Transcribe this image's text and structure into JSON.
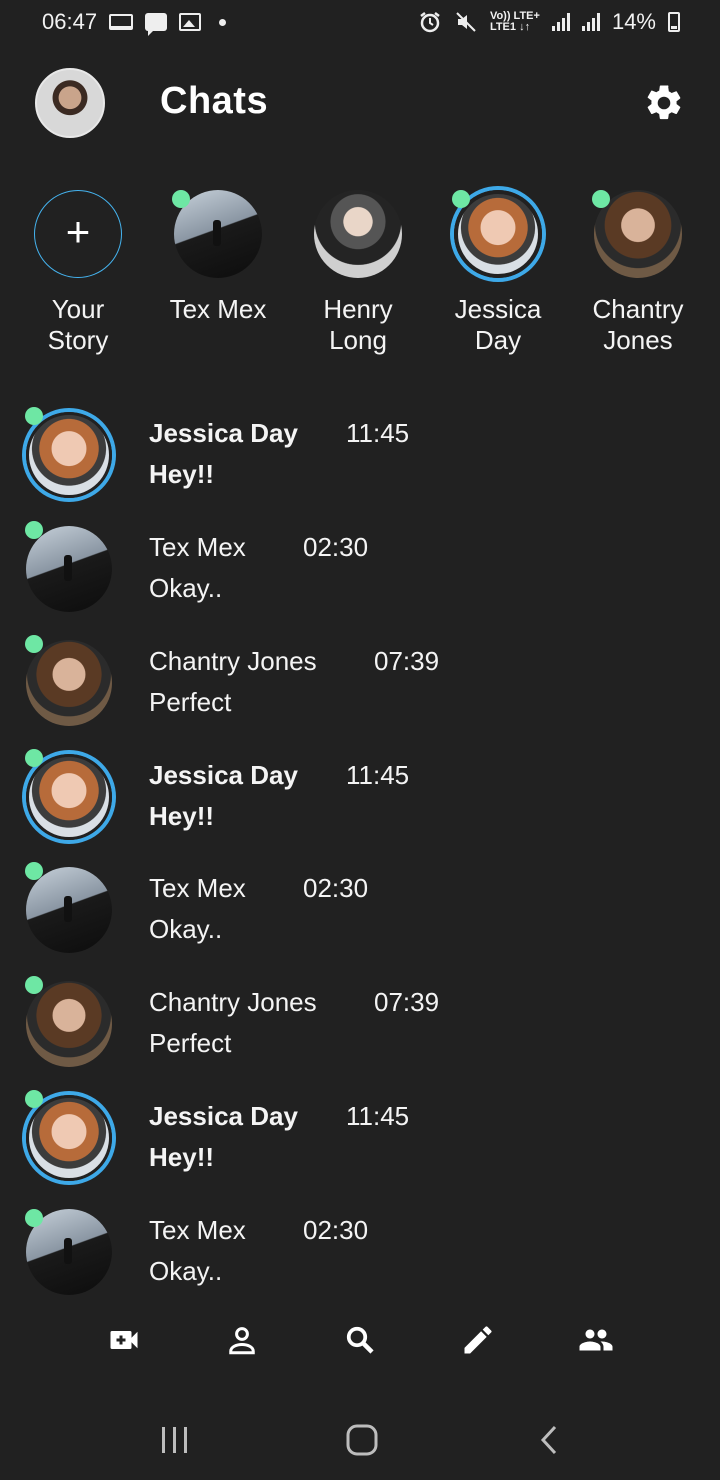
{
  "status_bar": {
    "time": "06:47",
    "network_top": "Vo)) LTE+",
    "network_bottom": "LTE1 ↓↑",
    "battery": "14%"
  },
  "header": {
    "title": "Chats",
    "avatar_icon": "profile-avatar",
    "settings_icon": "gear-icon"
  },
  "stories": [
    {
      "name_line1": "Your",
      "name_line2": "Story",
      "icon": "plus-icon"
    },
    {
      "name_line1": "Tex Mex",
      "name_line2": "",
      "online": true
    },
    {
      "name_line1": "Henry",
      "name_line2": "Long",
      "online": false
    },
    {
      "name_line1": "Jessica",
      "name_line2": "Day",
      "online": true
    },
    {
      "name_line1": "Chantry",
      "name_line2": "Jones",
      "online": true
    }
  ],
  "chats": [
    {
      "name": "Jessica Day",
      "time": "11:45",
      "message": "Hey!!",
      "unread": true
    },
    {
      "name": "Tex Mex",
      "time": "02:30",
      "message": "Okay..",
      "unread": false
    },
    {
      "name": "Chantry Jones",
      "time": "07:39",
      "message": "Perfect",
      "unread": false
    },
    {
      "name": "Jessica Day",
      "time": "11:45",
      "message": "Hey!!",
      "unread": true
    },
    {
      "name": "Tex Mex",
      "time": "02:30",
      "message": "Okay..",
      "unread": false
    },
    {
      "name": "Chantry Jones",
      "time": "07:39",
      "message": "Perfect",
      "unread": false
    },
    {
      "name": "Jessica Day",
      "time": "11:45",
      "message": "Hey!!",
      "unread": true
    },
    {
      "name": "Tex Mex",
      "time": "02:30",
      "message": "Okay..",
      "unread": false
    }
  ],
  "bottom_nav": [
    "video-call-icon",
    "person-icon",
    "search-icon",
    "pencil-icon",
    "group-icon"
  ],
  "system_nav": [
    "recent-apps-icon",
    "home-icon",
    "back-icon"
  ],
  "colors": {
    "background": "#212121",
    "accent_ring": "#3ea9e8",
    "online": "#6ee7a4",
    "text": "#ffffff"
  }
}
